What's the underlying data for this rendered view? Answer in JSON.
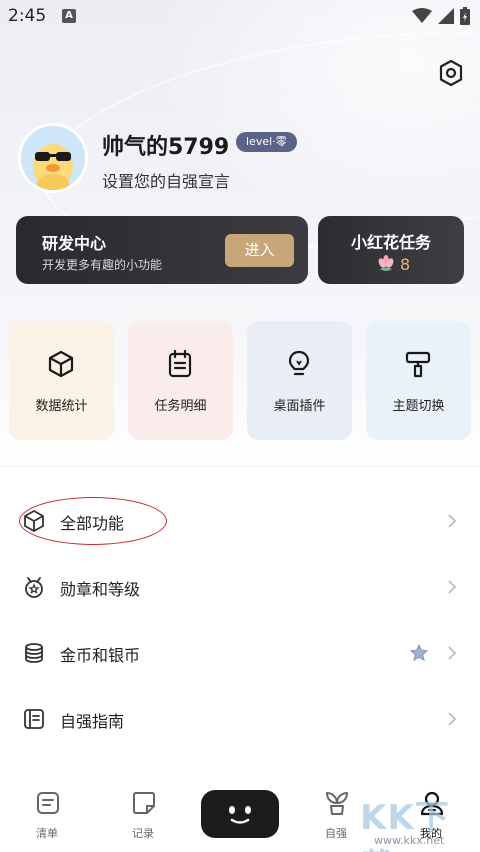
{
  "status_bar": {
    "time": "2:45",
    "notification": "A"
  },
  "profile": {
    "username": "帅气的5799",
    "level": "level·零",
    "motto": "设置您的自强宣言"
  },
  "rd_center": {
    "title": "研发中心",
    "subtitle": "开发更多有趣的小功能",
    "enter_label": "进入"
  },
  "flower_task": {
    "title": "小红花任务",
    "count": "8"
  },
  "quick_tiles": [
    {
      "label": "数据统计",
      "icon": "cube-icon",
      "bg": "#fbf1e4"
    },
    {
      "label": "任务明细",
      "icon": "notepad-icon",
      "bg": "#fbecec"
    },
    {
      "label": "桌面插件",
      "icon": "lightbulb-icon",
      "bg": "#e9edf6"
    },
    {
      "label": "主题切换",
      "icon": "paint-roller-icon",
      "bg": "#e9f1f9"
    }
  ],
  "menu": [
    {
      "label": "全部功能",
      "icon": "box-icon"
    },
    {
      "label": "勋章和等级",
      "icon": "medal-icon"
    },
    {
      "label": "金币和银币",
      "icon": "coins-icon"
    },
    {
      "label": "自强指南",
      "icon": "guide-icon"
    }
  ],
  "bottom_nav": [
    {
      "label": "清单",
      "icon": "list-icon"
    },
    {
      "label": "记录",
      "icon": "note-icon"
    },
    {
      "label": "自强",
      "icon": "sprout-icon"
    },
    {
      "label": "我的",
      "icon": "user-icon",
      "active": true
    }
  ],
  "watermark": {
    "text": "KK下载",
    "url": "www.kkx.net"
  },
  "colors": {
    "accent_gold": "#c8a679",
    "dark_card": "#2a2a2e",
    "level_badge": "#5b6288",
    "highlight_circle": "#c42b2b"
  }
}
